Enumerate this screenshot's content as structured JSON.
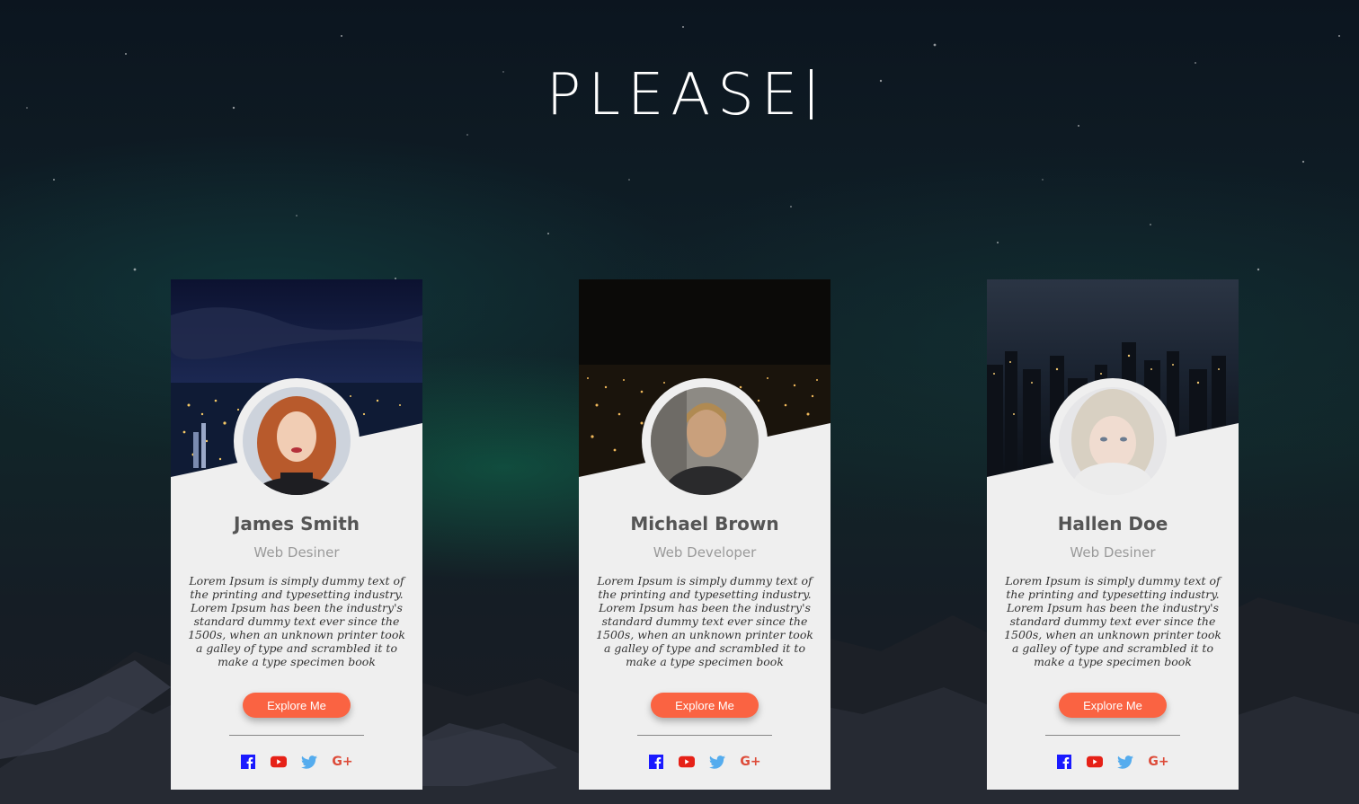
{
  "heading": {
    "text": "PLEASE"
  },
  "colors": {
    "button": "#fa6342",
    "facebook": "#1a1aff",
    "youtube": "#e62117",
    "twitter": "#55acee",
    "googleplus": "#dd4b39"
  },
  "cards": [
    {
      "name": "James Smith",
      "role": "Web Desiner",
      "description": "Lorem Ipsum is simply dummy text of the printing and typesetting industry. Lorem Ipsum has been the industry's standard dummy text ever since the 1500s, when an unknown printer took a galley of type and scrambled it to make a type specimen book",
      "button": "Explore Me",
      "socials": [
        "facebook-icon",
        "youtube-icon",
        "twitter-icon",
        "google-plus-icon"
      ]
    },
    {
      "name": "Michael Brown",
      "role": "Web Developer",
      "description": "Lorem Ipsum is simply dummy text of the printing and typesetting industry. Lorem Ipsum has been the industry's standard dummy text ever since the 1500s, when an unknown printer took a galley of type and scrambled it to make a type specimen book",
      "button": "Explore Me",
      "socials": [
        "facebook-icon",
        "youtube-icon",
        "twitter-icon",
        "google-plus-icon"
      ]
    },
    {
      "name": "Hallen Doe",
      "role": "Web Desiner",
      "description": "Lorem Ipsum is simply dummy text of the printing and typesetting industry. Lorem Ipsum has been the industry's standard dummy text ever since the 1500s, when an unknown printer took a galley of type and scrambled it to make a type specimen book",
      "button": "Explore Me",
      "socials": [
        "facebook-icon",
        "youtube-icon",
        "twitter-icon",
        "google-plus-icon"
      ]
    }
  ]
}
